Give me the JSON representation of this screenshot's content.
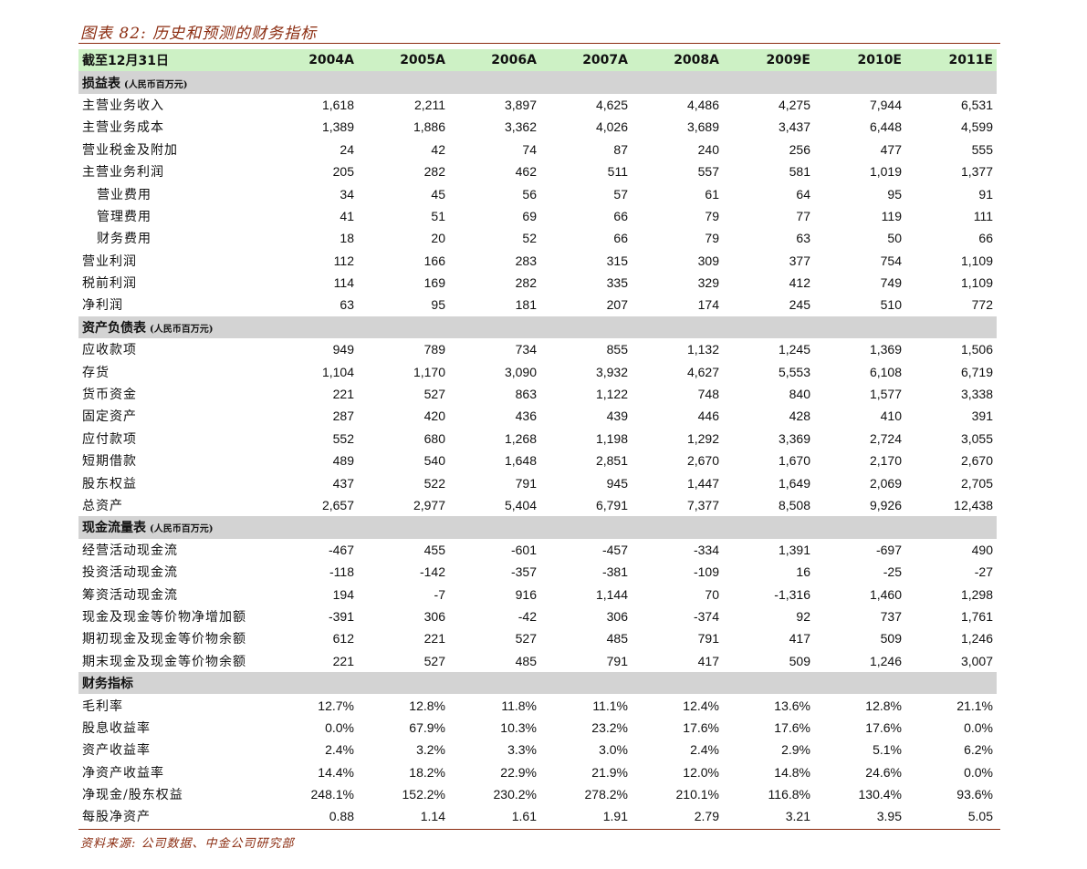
{
  "title": "图表 82: 历史和预测的财务指标",
  "source": "资料来源: 公司数据、中金公司研究部",
  "header": {
    "label": "截至12月31日",
    "years": [
      "2004A",
      "2005A",
      "2006A",
      "2007A",
      "2008A",
      "2009E",
      "2010E",
      "2011E"
    ]
  },
  "sections": [
    {
      "title": "损益表",
      "unit": "(人民币百万元)",
      "rows": [
        {
          "label": "主营业务收入",
          "indent": false,
          "values": [
            "1,618",
            "2,211",
            "3,897",
            "4,625",
            "4,486",
            "4,275",
            "7,944",
            "6,531"
          ]
        },
        {
          "label": "主营业务成本",
          "indent": false,
          "values": [
            "1,389",
            "1,886",
            "3,362",
            "4,026",
            "3,689",
            "3,437",
            "6,448",
            "4,599"
          ]
        },
        {
          "label": "营业税金及附加",
          "indent": false,
          "values": [
            "24",
            "42",
            "74",
            "87",
            "240",
            "256",
            "477",
            "555"
          ]
        },
        {
          "label": "主营业务利润",
          "indent": false,
          "values": [
            "205",
            "282",
            "462",
            "511",
            "557",
            "581",
            "1,019",
            "1,377"
          ]
        },
        {
          "label": "营业费用",
          "indent": true,
          "values": [
            "34",
            "45",
            "56",
            "57",
            "61",
            "64",
            "95",
            "91"
          ]
        },
        {
          "label": "管理费用",
          "indent": true,
          "values": [
            "41",
            "51",
            "69",
            "66",
            "79",
            "77",
            "119",
            "111"
          ]
        },
        {
          "label": "财务费用",
          "indent": true,
          "values": [
            "18",
            "20",
            "52",
            "66",
            "79",
            "63",
            "50",
            "66"
          ]
        },
        {
          "label": "营业利润",
          "indent": false,
          "values": [
            "112",
            "166",
            "283",
            "315",
            "309",
            "377",
            "754",
            "1,109"
          ]
        },
        {
          "label": "税前利润",
          "indent": false,
          "values": [
            "114",
            "169",
            "282",
            "335",
            "329",
            "412",
            "749",
            "1,109"
          ]
        },
        {
          "label": "净利润",
          "indent": false,
          "values": [
            "63",
            "95",
            "181",
            "207",
            "174",
            "245",
            "510",
            "772"
          ]
        }
      ]
    },
    {
      "title": "资产负债表",
      "unit": "(人民币百万元)",
      "rows": [
        {
          "label": "应收款项",
          "indent": false,
          "values": [
            "949",
            "789",
            "734",
            "855",
            "1,132",
            "1,245",
            "1,369",
            "1,506"
          ]
        },
        {
          "label": "存货",
          "indent": false,
          "values": [
            "1,104",
            "1,170",
            "3,090",
            "3,932",
            "4,627",
            "5,553",
            "6,108",
            "6,719"
          ]
        },
        {
          "label": "货币资金",
          "indent": false,
          "values": [
            "221",
            "527",
            "863",
            "1,122",
            "748",
            "840",
            "1,577",
            "3,338"
          ]
        },
        {
          "label": "固定资产",
          "indent": false,
          "values": [
            "287",
            "420",
            "436",
            "439",
            "446",
            "428",
            "410",
            "391"
          ]
        },
        {
          "label": "应付款项",
          "indent": false,
          "values": [
            "552",
            "680",
            "1,268",
            "1,198",
            "1,292",
            "3,369",
            "2,724",
            "3,055"
          ]
        },
        {
          "label": "短期借款",
          "indent": false,
          "values": [
            "489",
            "540",
            "1,648",
            "2,851",
            "2,670",
            "1,670",
            "2,170",
            "2,670"
          ]
        },
        {
          "label": "股东权益",
          "indent": false,
          "values": [
            "437",
            "522",
            "791",
            "945",
            "1,447",
            "1,649",
            "2,069",
            "2,705"
          ]
        },
        {
          "label": "总资产",
          "indent": false,
          "values": [
            "2,657",
            "2,977",
            "5,404",
            "6,791",
            "7,377",
            "8,508",
            "9,926",
            "12,438"
          ]
        }
      ]
    },
    {
      "title": "现金流量表",
      "unit": "(人民币百万元)",
      "rows": [
        {
          "label": "经营活动现金流",
          "indent": false,
          "values": [
            "-467",
            "455",
            "-601",
            "-457",
            "-334",
            "1,391",
            "-697",
            "490"
          ]
        },
        {
          "label": "投资活动现金流",
          "indent": false,
          "values": [
            "-118",
            "-142",
            "-357",
            "-381",
            "-109",
            "16",
            "-25",
            "-27"
          ]
        },
        {
          "label": "筹资活动现金流",
          "indent": false,
          "values": [
            "194",
            "-7",
            "916",
            "1,144",
            "70",
            "-1,316",
            "1,460",
            "1,298"
          ]
        },
        {
          "label": "现金及现金等价物净增加额",
          "indent": false,
          "values": [
            "-391",
            "306",
            "-42",
            "306",
            "-374",
            "92",
            "737",
            "1,761"
          ]
        },
        {
          "label": "期初现金及现金等价物余额",
          "indent": false,
          "values": [
            "612",
            "221",
            "527",
            "485",
            "791",
            "417",
            "509",
            "1,246"
          ]
        },
        {
          "label": "期末现金及现金等价物余额",
          "indent": false,
          "values": [
            "221",
            "527",
            "485",
            "791",
            "417",
            "509",
            "1,246",
            "3,007"
          ]
        }
      ]
    },
    {
      "title": "财务指标",
      "unit": "",
      "rows": [
        {
          "label": "毛利率",
          "indent": false,
          "values": [
            "12.7%",
            "12.8%",
            "11.8%",
            "11.1%",
            "12.4%",
            "13.6%",
            "12.8%",
            "21.1%"
          ]
        },
        {
          "label": "股息收益率",
          "indent": false,
          "values": [
            "0.0%",
            "67.9%",
            "10.3%",
            "23.2%",
            "17.6%",
            "17.6%",
            "17.6%",
            "0.0%"
          ]
        },
        {
          "label": "资产收益率",
          "indent": false,
          "values": [
            "2.4%",
            "3.2%",
            "3.3%",
            "3.0%",
            "2.4%",
            "2.9%",
            "5.1%",
            "6.2%"
          ]
        },
        {
          "label": "净资产收益率",
          "indent": false,
          "values": [
            "14.4%",
            "18.2%",
            "22.9%",
            "21.9%",
            "12.0%",
            "14.8%",
            "24.6%",
            "0.0%"
          ]
        },
        {
          "label": "净现金/股东权益",
          "indent": false,
          "values": [
            "248.1%",
            "152.2%",
            "230.2%",
            "278.2%",
            "210.1%",
            "116.8%",
            "130.4%",
            "93.6%"
          ]
        },
        {
          "label": "每股净资产",
          "indent": false,
          "values": [
            "0.88",
            "1.14",
            "1.61",
            "1.91",
            "2.79",
            "3.21",
            "3.95",
            "5.05"
          ]
        }
      ]
    }
  ]
}
